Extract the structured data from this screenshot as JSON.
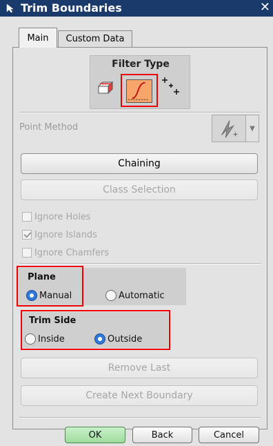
{
  "window": {
    "title": "Trim Boundaries",
    "close_glyph": "✕"
  },
  "tabs": [
    {
      "label": "Main"
    },
    {
      "label": "Custom Data"
    }
  ],
  "filter_type": {
    "title": "Filter Type",
    "icons": [
      "face-icon",
      "curve-icon",
      "points-icon"
    ],
    "selected": "curve-icon"
  },
  "point_method": {
    "label": "Point Method",
    "icon": "point-method-icon"
  },
  "buttons": {
    "chaining": "Chaining",
    "class_selection": "Class Selection",
    "remove_last": "Remove Last",
    "create_next_boundary": "Create Next Boundary"
  },
  "checkboxes": [
    {
      "label": "Ignore Holes",
      "checked": false
    },
    {
      "label": "Ignore Islands",
      "checked": true
    },
    {
      "label": "Ignore Chamfers",
      "checked": false
    }
  ],
  "plane": {
    "title": "Plane",
    "options": [
      "Manual",
      "Automatic"
    ],
    "selected": "Manual"
  },
  "trim_side": {
    "title": "Trim Side",
    "options": [
      "Inside",
      "Outside"
    ],
    "selected": "Outside"
  },
  "footer": {
    "ok": "OK",
    "back": "Back",
    "cancel": "Cancel"
  },
  "colors": {
    "titlebar": "#1a3a6c",
    "highlight": "#e00000",
    "ok_button": "#a8e0a8",
    "radio_on": "#2f78d8"
  }
}
